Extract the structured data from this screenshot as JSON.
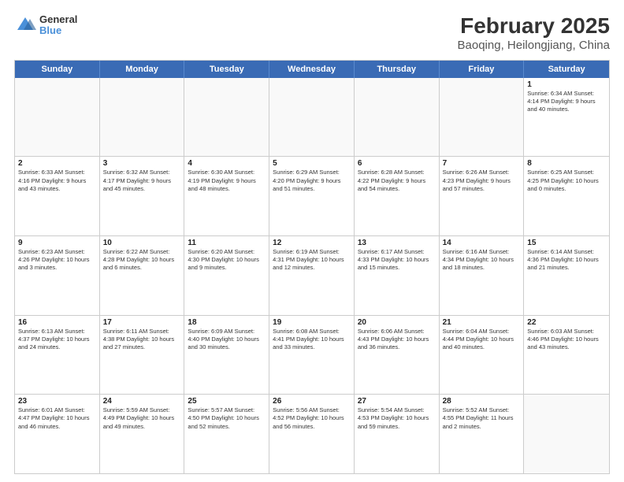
{
  "header": {
    "logo_line1": "General",
    "logo_line2": "Blue",
    "title": "February 2025",
    "subtitle": "Baoqing, Heilongjiang, China"
  },
  "weekdays": [
    "Sunday",
    "Monday",
    "Tuesday",
    "Wednesday",
    "Thursday",
    "Friday",
    "Saturday"
  ],
  "rows": [
    [
      {
        "day": "",
        "info": ""
      },
      {
        "day": "",
        "info": ""
      },
      {
        "day": "",
        "info": ""
      },
      {
        "day": "",
        "info": ""
      },
      {
        "day": "",
        "info": ""
      },
      {
        "day": "",
        "info": ""
      },
      {
        "day": "1",
        "info": "Sunrise: 6:34 AM\nSunset: 4:14 PM\nDaylight: 9 hours and 40 minutes."
      }
    ],
    [
      {
        "day": "2",
        "info": "Sunrise: 6:33 AM\nSunset: 4:16 PM\nDaylight: 9 hours and 43 minutes."
      },
      {
        "day": "3",
        "info": "Sunrise: 6:32 AM\nSunset: 4:17 PM\nDaylight: 9 hours and 45 minutes."
      },
      {
        "day": "4",
        "info": "Sunrise: 6:30 AM\nSunset: 4:19 PM\nDaylight: 9 hours and 48 minutes."
      },
      {
        "day": "5",
        "info": "Sunrise: 6:29 AM\nSunset: 4:20 PM\nDaylight: 9 hours and 51 minutes."
      },
      {
        "day": "6",
        "info": "Sunrise: 6:28 AM\nSunset: 4:22 PM\nDaylight: 9 hours and 54 minutes."
      },
      {
        "day": "7",
        "info": "Sunrise: 6:26 AM\nSunset: 4:23 PM\nDaylight: 9 hours and 57 minutes."
      },
      {
        "day": "8",
        "info": "Sunrise: 6:25 AM\nSunset: 4:25 PM\nDaylight: 10 hours and 0 minutes."
      }
    ],
    [
      {
        "day": "9",
        "info": "Sunrise: 6:23 AM\nSunset: 4:26 PM\nDaylight: 10 hours and 3 minutes."
      },
      {
        "day": "10",
        "info": "Sunrise: 6:22 AM\nSunset: 4:28 PM\nDaylight: 10 hours and 6 minutes."
      },
      {
        "day": "11",
        "info": "Sunrise: 6:20 AM\nSunset: 4:30 PM\nDaylight: 10 hours and 9 minutes."
      },
      {
        "day": "12",
        "info": "Sunrise: 6:19 AM\nSunset: 4:31 PM\nDaylight: 10 hours and 12 minutes."
      },
      {
        "day": "13",
        "info": "Sunrise: 6:17 AM\nSunset: 4:33 PM\nDaylight: 10 hours and 15 minutes."
      },
      {
        "day": "14",
        "info": "Sunrise: 6:16 AM\nSunset: 4:34 PM\nDaylight: 10 hours and 18 minutes."
      },
      {
        "day": "15",
        "info": "Sunrise: 6:14 AM\nSunset: 4:36 PM\nDaylight: 10 hours and 21 minutes."
      }
    ],
    [
      {
        "day": "16",
        "info": "Sunrise: 6:13 AM\nSunset: 4:37 PM\nDaylight: 10 hours and 24 minutes."
      },
      {
        "day": "17",
        "info": "Sunrise: 6:11 AM\nSunset: 4:38 PM\nDaylight: 10 hours and 27 minutes."
      },
      {
        "day": "18",
        "info": "Sunrise: 6:09 AM\nSunset: 4:40 PM\nDaylight: 10 hours and 30 minutes."
      },
      {
        "day": "19",
        "info": "Sunrise: 6:08 AM\nSunset: 4:41 PM\nDaylight: 10 hours and 33 minutes."
      },
      {
        "day": "20",
        "info": "Sunrise: 6:06 AM\nSunset: 4:43 PM\nDaylight: 10 hours and 36 minutes."
      },
      {
        "day": "21",
        "info": "Sunrise: 6:04 AM\nSunset: 4:44 PM\nDaylight: 10 hours and 40 minutes."
      },
      {
        "day": "22",
        "info": "Sunrise: 6:03 AM\nSunset: 4:46 PM\nDaylight: 10 hours and 43 minutes."
      }
    ],
    [
      {
        "day": "23",
        "info": "Sunrise: 6:01 AM\nSunset: 4:47 PM\nDaylight: 10 hours and 46 minutes."
      },
      {
        "day": "24",
        "info": "Sunrise: 5:59 AM\nSunset: 4:49 PM\nDaylight: 10 hours and 49 minutes."
      },
      {
        "day": "25",
        "info": "Sunrise: 5:57 AM\nSunset: 4:50 PM\nDaylight: 10 hours and 52 minutes."
      },
      {
        "day": "26",
        "info": "Sunrise: 5:56 AM\nSunset: 4:52 PM\nDaylight: 10 hours and 56 minutes."
      },
      {
        "day": "27",
        "info": "Sunrise: 5:54 AM\nSunset: 4:53 PM\nDaylight: 10 hours and 59 minutes."
      },
      {
        "day": "28",
        "info": "Sunrise: 5:52 AM\nSunset: 4:55 PM\nDaylight: 11 hours and 2 minutes."
      },
      {
        "day": "",
        "info": ""
      }
    ]
  ]
}
